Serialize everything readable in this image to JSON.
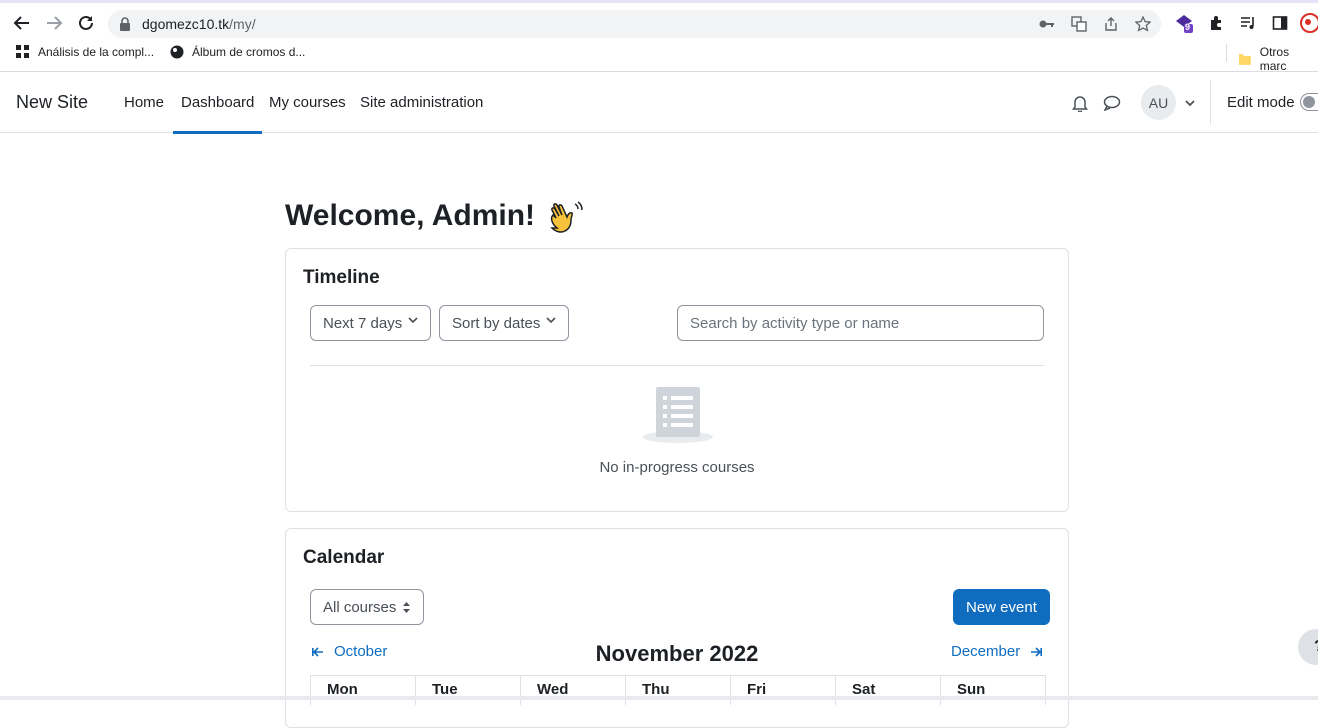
{
  "browser": {
    "url_host": "dgomezc10.tk",
    "url_path": "/my/",
    "extension_badge": "9",
    "bookmarks": [
      {
        "label": "Análisis de la compl..."
      },
      {
        "label": "Álbum de cromos d..."
      }
    ],
    "other_bookmarks": "Otros marc"
  },
  "navbar": {
    "brand": "New Site",
    "links": [
      {
        "label": "Home"
      },
      {
        "label": "Dashboard",
        "active": true
      },
      {
        "label": "My courses"
      },
      {
        "label": "Site administration"
      }
    ],
    "avatar_initials": "AU",
    "edit_mode_label": "Edit mode"
  },
  "page": {
    "welcome": "Welcome, Admin!",
    "welcome_emoji": "👋"
  },
  "timeline": {
    "title": "Timeline",
    "filter_label": "Next 7 days",
    "sort_label": "Sort by dates",
    "search_placeholder": "Search by activity type or name",
    "empty_message": "No in-progress courses"
  },
  "calendar": {
    "title": "Calendar",
    "course_filter": "All courses",
    "new_event_label": "New event",
    "prev_month": "October",
    "next_month": "December",
    "month_title": "November 2022",
    "days": [
      "Mon",
      "Tue",
      "Wed",
      "Thu",
      "Fri",
      "Sat",
      "Sun"
    ]
  },
  "help": {
    "label": "?"
  },
  "colors": {
    "primary": "#0f6cbf",
    "border": "#dee2e6",
    "text": "#1d2125"
  }
}
